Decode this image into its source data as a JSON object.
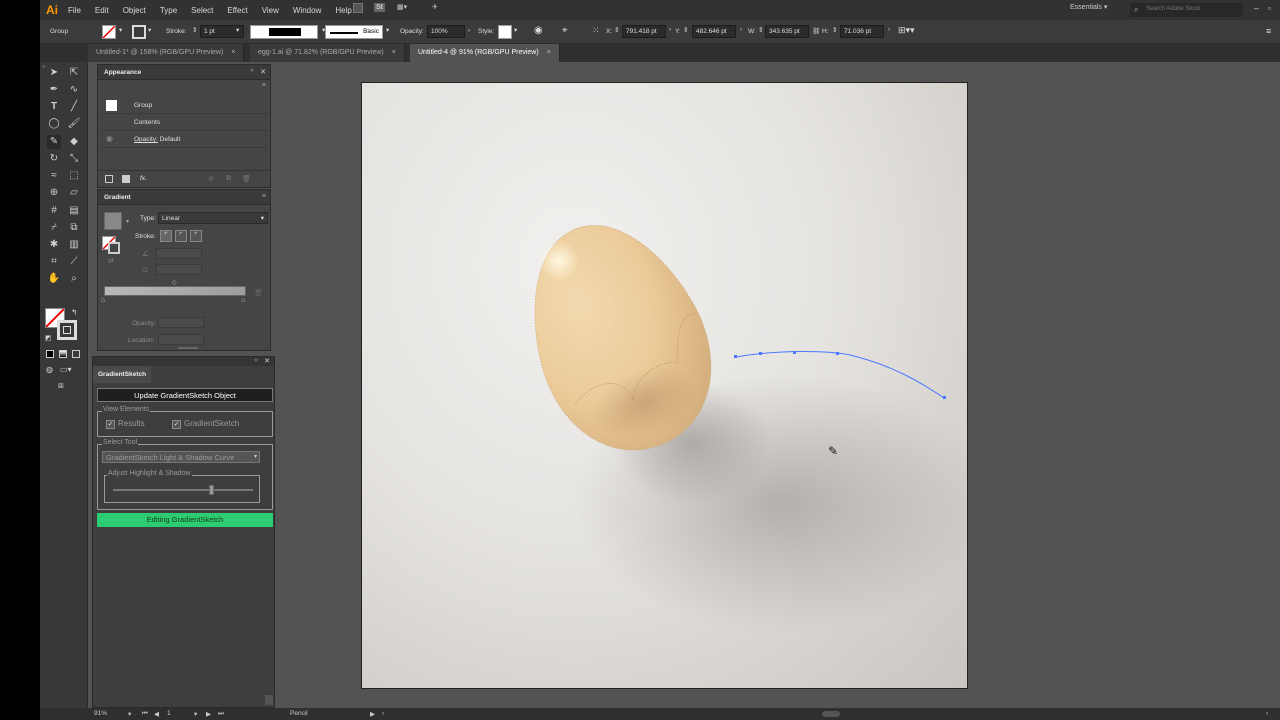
{
  "menubar": {
    "logo": "Ai",
    "items": [
      "File",
      "Edit",
      "Object",
      "Type",
      "Select",
      "Effect",
      "View",
      "Window",
      "Help"
    ],
    "workspace": "Essentials",
    "search_placeholder": "Search Adobe Stock"
  },
  "control": {
    "selection": "Group",
    "stroke_label": "Stroke:",
    "stroke_value": "1 pt",
    "brush": "Basic",
    "opacity_label": "Opacity:",
    "opacity_value": "100%",
    "style_label": "Style:",
    "x_label": "X:",
    "x_value": "791.418 pt",
    "y_label": "Y:",
    "y_value": "482.646 pt",
    "w_label": "W:",
    "w_value": "343.635 pt",
    "h_label": "H:",
    "h_value": "71.036 pt"
  },
  "tabs": [
    {
      "label": "Untitled-1* @ 158% (RGB/GPU Preview)",
      "close": "×"
    },
    {
      "label": "egg-1.ai @ 71.82% (RGB/GPU Preview)",
      "close": "×"
    },
    {
      "label": "Untitled-4 @ 91% (RGB/GPU Preview)",
      "close": "×"
    }
  ],
  "appearance": {
    "title": "Appearance",
    "group": "Group",
    "contents": "Contents",
    "opacity_label": "Opacity:",
    "opacity_value": "Default",
    "fx": "fx."
  },
  "gradient": {
    "title": "Gradient",
    "type_label": "Type:",
    "type_value": "Linear",
    "stroke_label": "Stroke:",
    "opacity_label": "Opacity:",
    "location_label": "Location:"
  },
  "gradientsketch": {
    "title": "GradientSketch",
    "update_button": "Update GradientSketch Object",
    "view_elements": "View Elements",
    "results": "Results",
    "gs_checkbox": "GradientSketch",
    "select_tool": "Select Tool",
    "tool_value": "GradientSketch Light & Shadow Curve",
    "adjust": "Adjust Highlight & Shadow",
    "adjust_value": 0.7,
    "editing_button": "Editing GradientSketch"
  },
  "status": {
    "zoom": "91%",
    "page": "1",
    "tool": "Pencil"
  },
  "colors": {
    "accent_green": "#2ecc71",
    "path_blue": "#4a78ff",
    "egg_light": "#f0d4a8",
    "egg_dark": "#d3ad7a",
    "logo_orange": "#ff9a00"
  },
  "icons": [
    "selection-icon",
    "direct-selection-icon",
    "pen-icon",
    "curvature-icon",
    "type-icon",
    "line-icon",
    "ellipse-icon",
    "paintbrush-icon",
    "pencil-icon",
    "eraser-icon",
    "rotate-icon",
    "scale-icon",
    "warp-icon",
    "free-transform-icon",
    "shape-builder-icon",
    "perspective-icon",
    "mesh-icon",
    "gradient-icon",
    "eyedropper-icon",
    "blend-icon",
    "symbol-sprayer-icon",
    "graph-icon",
    "artboard-icon",
    "slice-icon",
    "hand-icon",
    "zoom-icon"
  ]
}
